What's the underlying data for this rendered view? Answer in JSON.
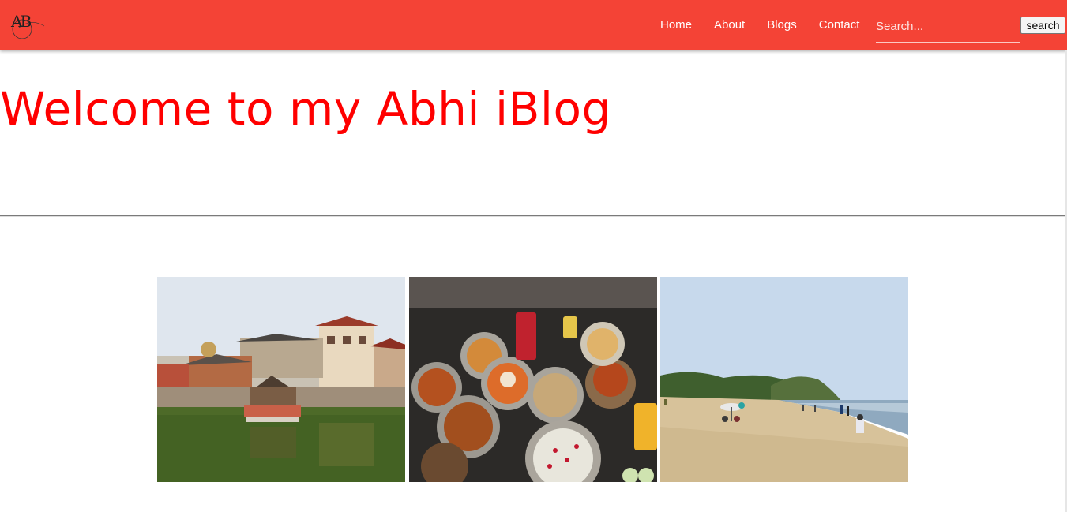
{
  "brand": {
    "logo_letters": "AB"
  },
  "nav": {
    "links": [
      {
        "label": "Home"
      },
      {
        "label": "About"
      },
      {
        "label": "Blogs"
      },
      {
        "label": "Contact"
      }
    ],
    "search": {
      "placeholder": "Search...",
      "value": "",
      "button_label": "search"
    }
  },
  "colors": {
    "navbar": "#f44336",
    "title": "#ff0000"
  },
  "main": {
    "title": "Welcome to my Abhi iBlog"
  }
}
